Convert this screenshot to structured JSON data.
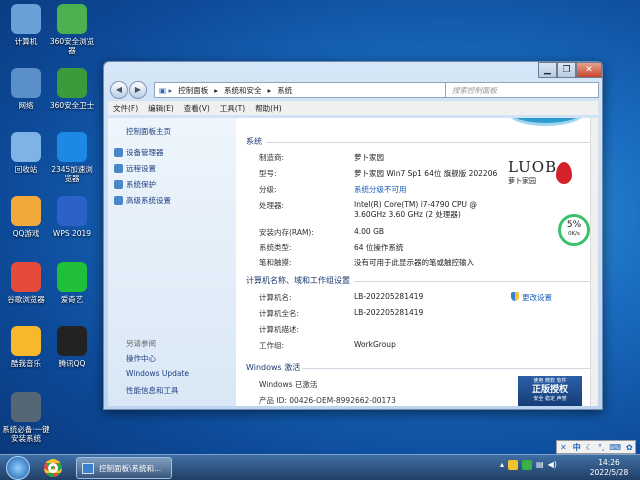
{
  "desktop": {
    "icons": [
      {
        "label": "计算机",
        "icon": "computer-icon",
        "color": "#6aa0d8"
      },
      {
        "label": "360安全浏览器",
        "icon": "browser-360-icon",
        "color": "#4caf50"
      },
      {
        "label": "网络",
        "icon": "network-icon",
        "color": "#5b8fc9"
      },
      {
        "label": "360安全卫士",
        "icon": "guard-360-icon",
        "color": "#3a9b3a"
      },
      {
        "label": "回收站",
        "icon": "recycle-bin-icon",
        "color": "#7fb2e6"
      },
      {
        "label": "2345加速浏览器",
        "icon": "browser-2345-icon",
        "color": "#1e88e5"
      },
      {
        "label": "QQ游戏",
        "icon": "qq-game-icon",
        "color": "#f2a93b"
      },
      {
        "label": "WPS 2019",
        "icon": "wps-icon",
        "color": "#2c62c7"
      },
      {
        "label": "谷歌浏览器",
        "icon": "chrome-icon",
        "color": "#e44b3b"
      },
      {
        "label": "爱奇艺",
        "icon": "iqiyi-icon",
        "color": "#1fbf3a"
      },
      {
        "label": "酷我音乐",
        "icon": "kuwo-icon",
        "color": "#f7b82e"
      },
      {
        "label": "腾讯QQ",
        "icon": "qq-icon",
        "color": "#222222"
      },
      {
        "label": "系统必备·一键安装系统",
        "icon": "installer-icon",
        "color": "#556677"
      }
    ]
  },
  "window": {
    "breadcrumb": [
      "控制面板",
      "系统和安全",
      "系统"
    ],
    "search_placeholder": "搜索控制面板",
    "menu": [
      "文件(F)",
      "编辑(E)",
      "查看(V)",
      "工具(T)",
      "帮助(H)"
    ],
    "left_panel": {
      "home": "控制面板主页",
      "links": [
        "设备管理器",
        "远程设置",
        "系统保护",
        "高级系统设置"
      ],
      "see_also_title": "另请参阅",
      "see_also": [
        "操作中心",
        "Windows Update",
        "性能信息和工具"
      ]
    },
    "system": {
      "section_title": "系统",
      "rows": [
        {
          "label": "制造商:",
          "value": "萝卜家园"
        },
        {
          "label": "型号:",
          "value": "萝卜家园 Win7 Sp1 64位 旗舰版 202206"
        },
        {
          "label": "分级:",
          "value": "系统分级不可用"
        },
        {
          "label": "处理器:",
          "value": "Intel(R) Core(TM) i7-4790 CPU @ 3.60GHz   3.60 GHz  (2 处理器)"
        },
        {
          "label": "安装内存(RAM):",
          "value": "4.00 GB"
        },
        {
          "label": "系统类型:",
          "value": "64 位操作系统"
        },
        {
          "label": "笔和触摸:",
          "value": "没有可用于此显示器的笔或触控输入"
        }
      ]
    },
    "computer": {
      "section_title": "计算机名称、域和工作组设置",
      "change_label": "更改设置",
      "rows": [
        {
          "label": "计算机名:",
          "value": "LB-202205281419"
        },
        {
          "label": "计算机全名:",
          "value": "LB-202205281419"
        },
        {
          "label": "计算机描述:",
          "value": ""
        },
        {
          "label": "工作组:",
          "value": "WorkGroup"
        }
      ]
    },
    "activation": {
      "section_title": "Windows 激活",
      "status": "Windows 已激活",
      "product_id": "产品 ID: 00426-OEM-8992662-00173",
      "badge_top": "使用 微软 软件",
      "badge_main": "正版授权",
      "badge_sub": "安全 稳定 声誉"
    },
    "logo_text": "LUOB",
    "logo_sub": "萝卜家园",
    "speed_widget": {
      "percent": "5%",
      "rate": "0K/s"
    }
  },
  "taskbar": {
    "task_label": "控制面板\\系统和...",
    "time": "14:26",
    "date": "2022/5/28",
    "ime_label": "中"
  }
}
